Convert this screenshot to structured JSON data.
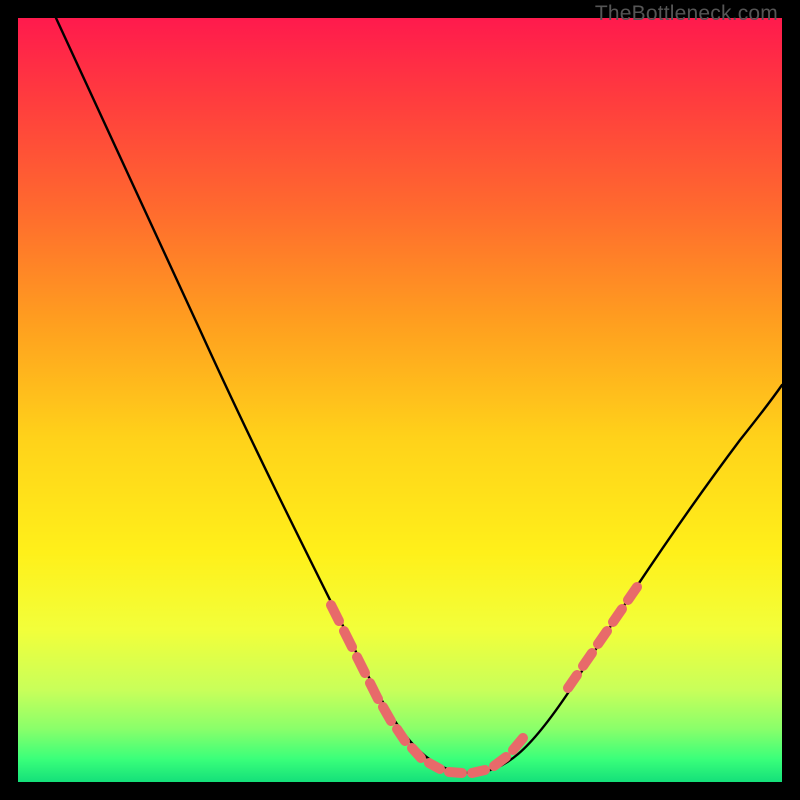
{
  "watermark": {
    "text": "TheBottleneck.com"
  },
  "chart_data": {
    "type": "line",
    "title": "",
    "xlabel": "",
    "ylabel": "",
    "xlim": [
      0,
      100
    ],
    "ylim": [
      0,
      100
    ],
    "grid": false,
    "legend": false,
    "series": [
      {
        "name": "curve",
        "color": "#000000",
        "x": [
          5,
          10,
          15,
          20,
          25,
          30,
          35,
          40,
          45,
          50,
          55,
          57,
          60,
          62,
          65,
          70,
          75,
          80,
          85,
          90,
          95,
          100
        ],
        "values": [
          100,
          92,
          83,
          74,
          65,
          55,
          45,
          36,
          27,
          18,
          10,
          6,
          2,
          1,
          1,
          3,
          8,
          15,
          23,
          32,
          41,
          50
        ]
      }
    ],
    "highlight_segments": [
      {
        "x": [
          40,
          57
        ],
        "color": "#e86a6a"
      },
      {
        "x": [
          70,
          80
        ],
        "color": "#e86a6a"
      }
    ],
    "annotations": []
  }
}
